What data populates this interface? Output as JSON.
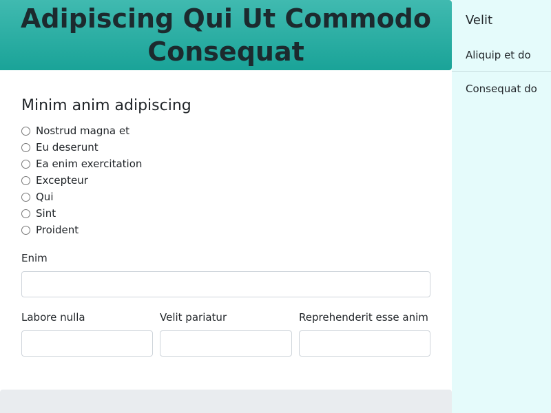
{
  "hero": {
    "title": "Adipiscing Qui Ut Commodo Consequat"
  },
  "form": {
    "section_title": "Minim anim adipiscing",
    "radio_options": [
      "Nostrud magna et",
      "Eu deserunt",
      "Ea enim exercitation",
      "Excepteur",
      "Qui",
      "Sint",
      "Proident"
    ],
    "enim_label": "Enim",
    "labore_label": "Labore nulla",
    "velit_label": "Velit pariatur",
    "reprehenderit_label": "Reprehenderit esse anim"
  },
  "sidebar": {
    "title": "Velit",
    "items": [
      "Aliquip et do",
      "Consequat do"
    ]
  },
  "colors": {
    "hero_gradient_top": "#40bab0",
    "hero_gradient_bottom": "#1aa398",
    "sidebar_bg": "#e5fbfb",
    "footer_bg": "#e9ecef"
  }
}
